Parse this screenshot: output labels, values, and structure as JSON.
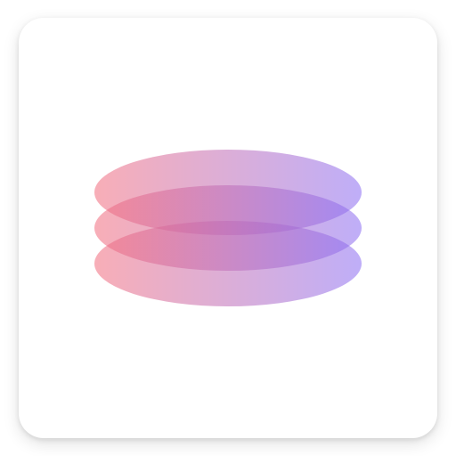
{
  "app_icon": {
    "icon_name": "stacked-layers-icon",
    "layer_count": 3,
    "colors": {
      "card_background": "#ffffff",
      "gradient_start": "#f26b7c",
      "gradient_end": "#8a6cf2"
    }
  }
}
